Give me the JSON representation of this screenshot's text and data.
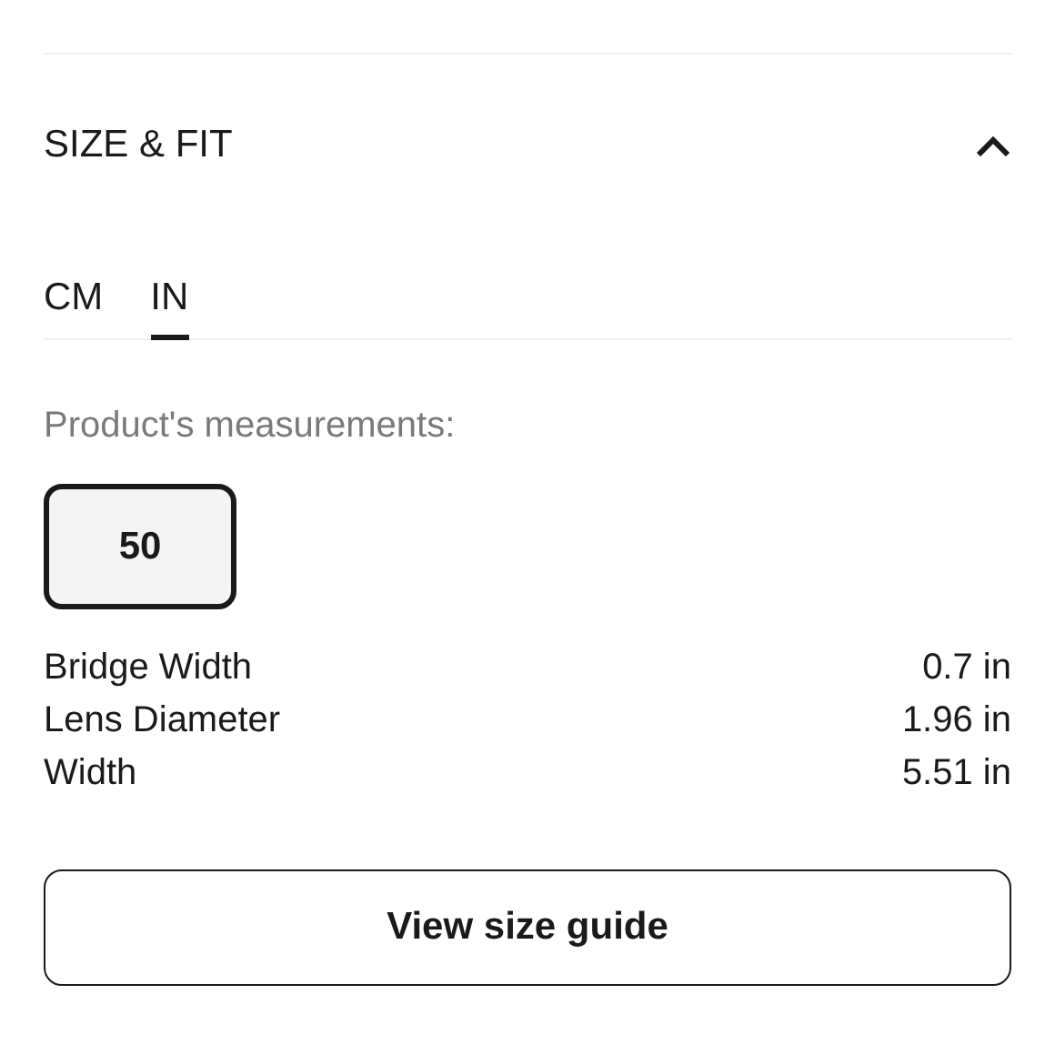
{
  "section": {
    "title": "SIZE & FIT",
    "expanded": true
  },
  "unit_tabs": [
    {
      "label": "CM",
      "selected": false
    },
    {
      "label": "IN",
      "selected": true
    }
  ],
  "measurements_label": "Product's measurements:",
  "sizes": [
    {
      "label": "50",
      "selected": true
    }
  ],
  "measurements": [
    {
      "name": "Bridge Width",
      "value": "0.7 in"
    },
    {
      "name": "Lens Diameter",
      "value": "1.96 in"
    },
    {
      "name": "Width",
      "value": "5.51 in"
    }
  ],
  "button": "View size guide"
}
